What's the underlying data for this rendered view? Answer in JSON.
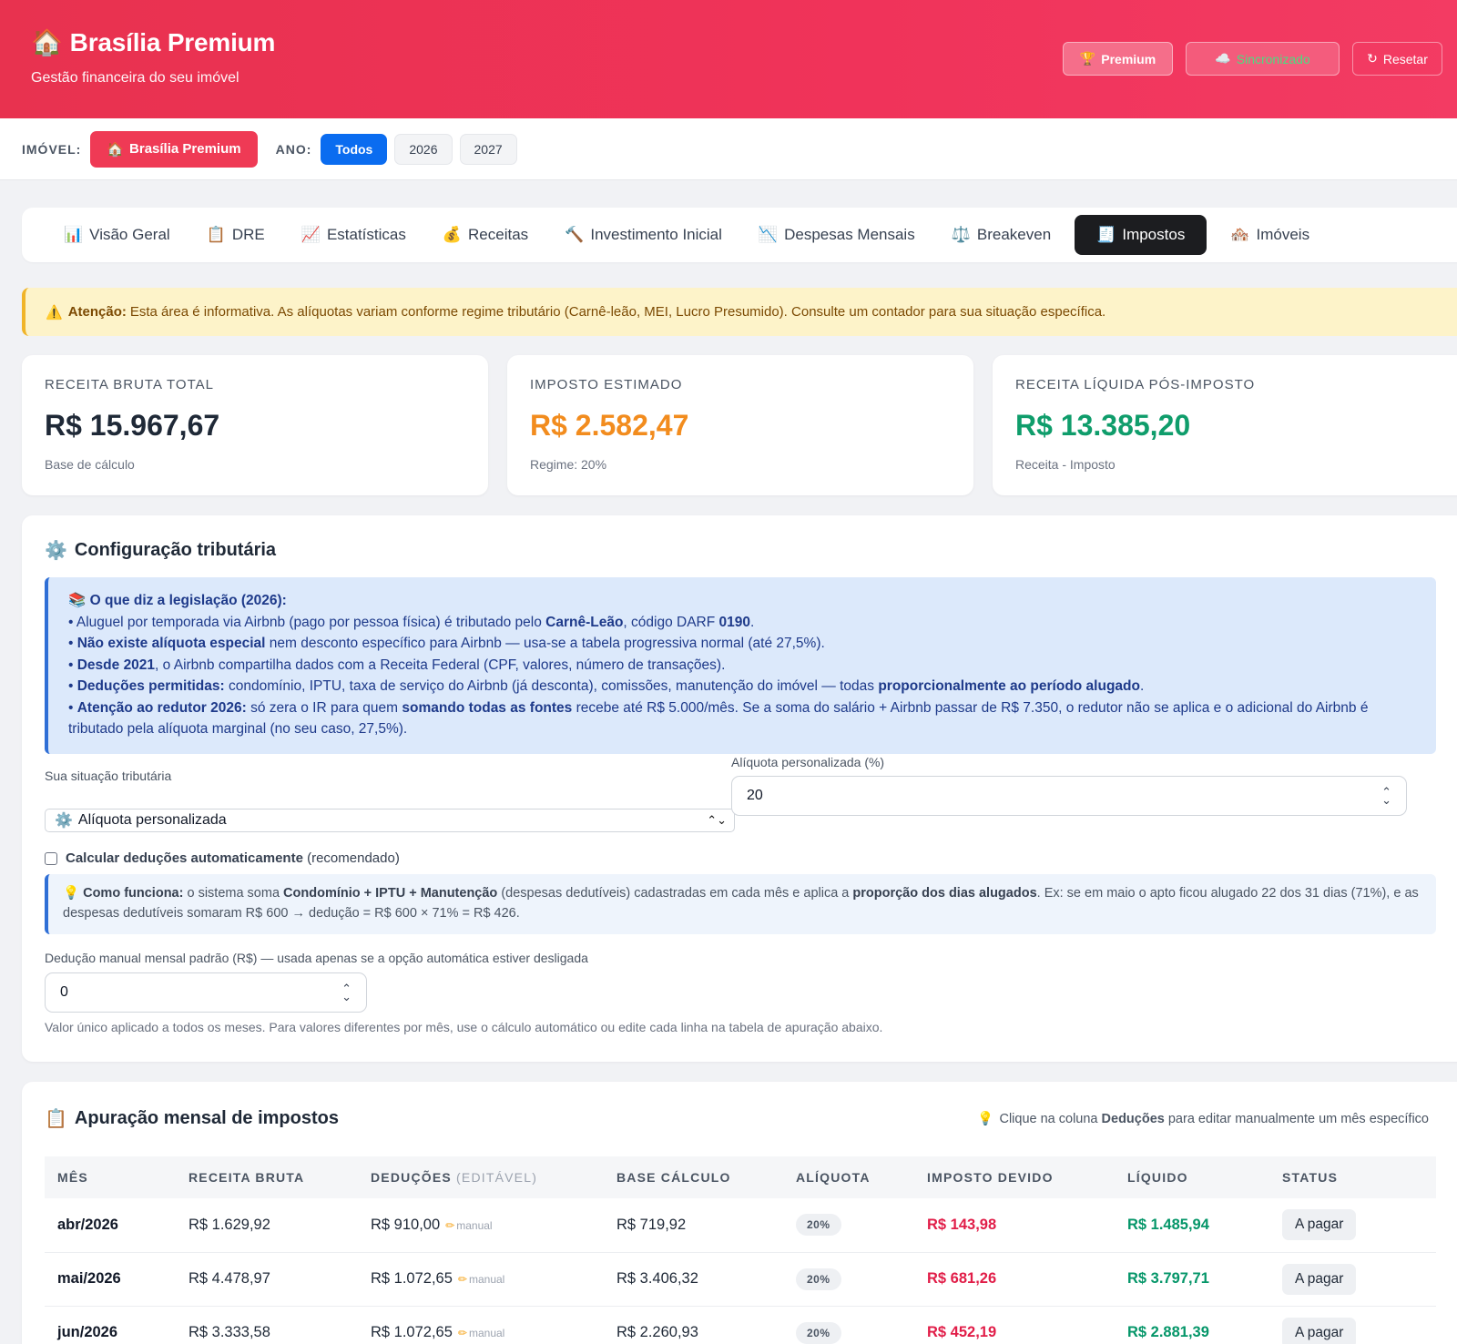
{
  "header": {
    "icon": "🏠",
    "title": "Brasília Premium",
    "subtitle": "Gestão financeira do seu imóvel",
    "buttons": {
      "premium": {
        "icon": "🏆",
        "label": "Premium"
      },
      "sync": {
        "icon": "☁️",
        "label": "Sincronizado"
      },
      "reset": {
        "icon": "↻",
        "label": "Resetar"
      }
    }
  },
  "filters": {
    "property_label": "IMÓVEL:",
    "property_icon": "🏠",
    "property_value": "Brasília Premium",
    "year_label": "ANO:",
    "years": [
      "Todos",
      "2026",
      "2027"
    ],
    "active_year": "Todos"
  },
  "tabs": [
    {
      "icon": "📊",
      "label": "Visão Geral"
    },
    {
      "icon": "📋",
      "label": "DRE"
    },
    {
      "icon": "📈",
      "label": "Estatísticas"
    },
    {
      "icon": "💰",
      "label": "Receitas"
    },
    {
      "icon": "🔨",
      "label": "Investimento Inicial"
    },
    {
      "icon": "📉",
      "label": "Despesas Mensais"
    },
    {
      "icon": "⚖️",
      "label": "Breakeven"
    },
    {
      "icon": "🧾",
      "label": "Impostos"
    },
    {
      "icon": "🏘️",
      "label": "Imóveis"
    }
  ],
  "active_tab": "Impostos",
  "alert": {
    "icon": "⚠️",
    "title": "Atenção:",
    "text": "Esta área é informativa. As alíquotas variam conforme regime tributário (Carnê-leão, MEI, Lucro Presumido). Consulte um contador para sua situação específica."
  },
  "stats": [
    {
      "label": "RECEITA BRUTA TOTAL",
      "value": "R$ 15.967,67",
      "sub": "Base de cálculo",
      "color": "#1f2937"
    },
    {
      "label": "IMPOSTO ESTIMADO",
      "value": "R$ 2.582,47",
      "sub": "Regime: 20%",
      "color": "#f28c1e"
    },
    {
      "label": "RECEITA LÍQUIDA PÓS-IMPOSTO",
      "value": "R$ 13.385,20",
      "sub": "Receita - Imposto",
      "color": "#0f9d6b"
    }
  ],
  "config": {
    "icon": "⚙️",
    "title": "Configuração tributária",
    "legis": {
      "icon": "📚",
      "title": "O que diz a legislação (2026):",
      "l1a": "• Aluguel por temporada via Airbnb (pago por pessoa física) é tributado pelo ",
      "l1b": "Carnê-Leão",
      "l1c": ", código DARF ",
      "l1d": "0190",
      "l1e": ".",
      "l2a": "• ",
      "l2b": "Não existe alíquota especial",
      "l2c": " nem desconto específico para Airbnb — usa-se a tabela progressiva normal (até 27,5%).",
      "l3a": "• ",
      "l3b": "Desde 2021",
      "l3c": ", o Airbnb compartilha dados com a Receita Federal (CPF, valores, número de transações).",
      "l4a": "• ",
      "l4b": "Deduções permitidas:",
      "l4c": " condomínio, IPTU, taxa de serviço do Airbnb (já desconta), comissões, manutenção do imóvel — todas ",
      "l4d": "proporcionalmente ao período alugado",
      "l4e": ".",
      "l5a": "• ",
      "l5b": "Atenção ao redutor 2026:",
      "l5c": " só zera o IR para quem ",
      "l5d": "somando todas as fontes",
      "l5e": " recebe até R$ 5.000/mês. Se a soma do salário + Airbnb passar de R$ 7.350, o redutor não se aplica e o adicional do Airbnb é tributado pela alíquota marginal (no seu caso, 27,5%)."
    },
    "situation_label": "Sua situação tributária",
    "situation_icon": "⚙️",
    "situation_value": "Alíquota personalizada",
    "rate_label": "Alíquota personalizada (%)",
    "rate_value": "20",
    "auto_label": "Calcular deduções automaticamente",
    "auto_suffix": " (recomendado)",
    "how": {
      "icon": "💡",
      "a": "Como funciona:",
      "b": " o sistema soma ",
      "c": "Condomínio + IPTU + Manutenção",
      "d": " (despesas dedutíveis) cadastradas em cada mês e aplica a ",
      "e": "proporção dos dias alugados",
      "f": ". Ex: se em maio o apto ficou alugado 22 dos 31 dias (71%), e as despesas dedutíveis somaram R$ 600 → dedução = R$ 600 × 71% = R$ 426."
    },
    "manual_label": "Dedução manual mensal padrão (R$) — usada apenas se a opção automática estiver desligada",
    "manual_value": "0",
    "manual_help": "Valor único aplicado a todos os meses. Para valores diferentes por mês, use o cálculo automático ou edite cada linha na tabela de apuração abaixo."
  },
  "apuracao": {
    "icon": "📋",
    "title": "Apuração mensal de impostos",
    "hint_icon": "💡",
    "hint_a": "Clique na coluna ",
    "hint_b": "Deduções",
    "hint_c": " para editar manualmente um mês específico",
    "columns": {
      "month": "MÊS",
      "gross": "RECEITA BRUTA",
      "deductions": "DEDUÇÕES",
      "deductions_note": " (EDITÁVEL)",
      "base": "BASE CÁLCULO",
      "rate": "ALÍQUOTA",
      "tax": "IMPOSTO DEVIDO",
      "net": "LÍQUIDO",
      "status": "STATUS"
    },
    "manual_tag": "manual",
    "rows": [
      {
        "month": "abr/2026",
        "gross": "R$ 1.629,92",
        "deductions": "R$ 910,00",
        "base": "R$ 719,92",
        "rate": "20%",
        "tax": "R$ 143,98",
        "net": "R$ 1.485,94",
        "status": "A pagar"
      },
      {
        "month": "mai/2026",
        "gross": "R$ 4.478,97",
        "deductions": "R$ 1.072,65",
        "base": "R$ 3.406,32",
        "rate": "20%",
        "tax": "R$ 681,26",
        "net": "R$ 3.797,71",
        "status": "A pagar"
      },
      {
        "month": "jun/2026",
        "gross": "R$ 3.333,58",
        "deductions": "R$ 1.072,65",
        "base": "R$ 2.260,93",
        "rate": "20%",
        "tax": "R$ 452,19",
        "net": "R$ 2.881,39",
        "status": "A pagar"
      }
    ]
  }
}
